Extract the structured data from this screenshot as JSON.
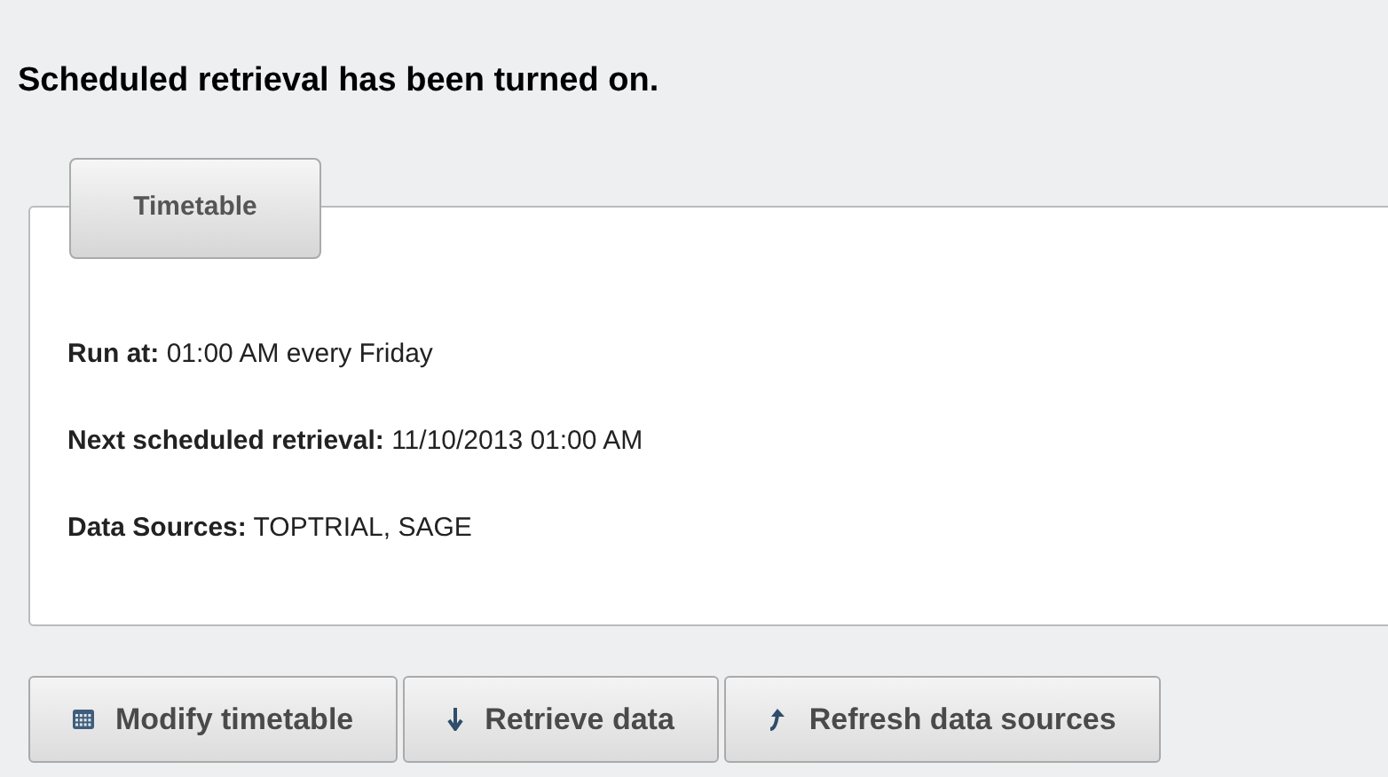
{
  "message": "Scheduled retrieval has been turned on.",
  "panel": {
    "legend": "Timetable",
    "details": [
      {
        "label": "Run at:",
        "value": "01:00 AM every Friday"
      },
      {
        "label": "Next scheduled retrieval:",
        "value": "11/10/2013 01:00 AM"
      },
      {
        "label": "Data Sources:",
        "value": "TOPTRIAL, SAGE"
      }
    ]
  },
  "buttons": [
    {
      "kind": "calendar",
      "label": "Modify timetable"
    },
    {
      "kind": "download",
      "label": "Retrieve data"
    },
    {
      "kind": "refresh",
      "label": "Refresh data sources"
    }
  ]
}
